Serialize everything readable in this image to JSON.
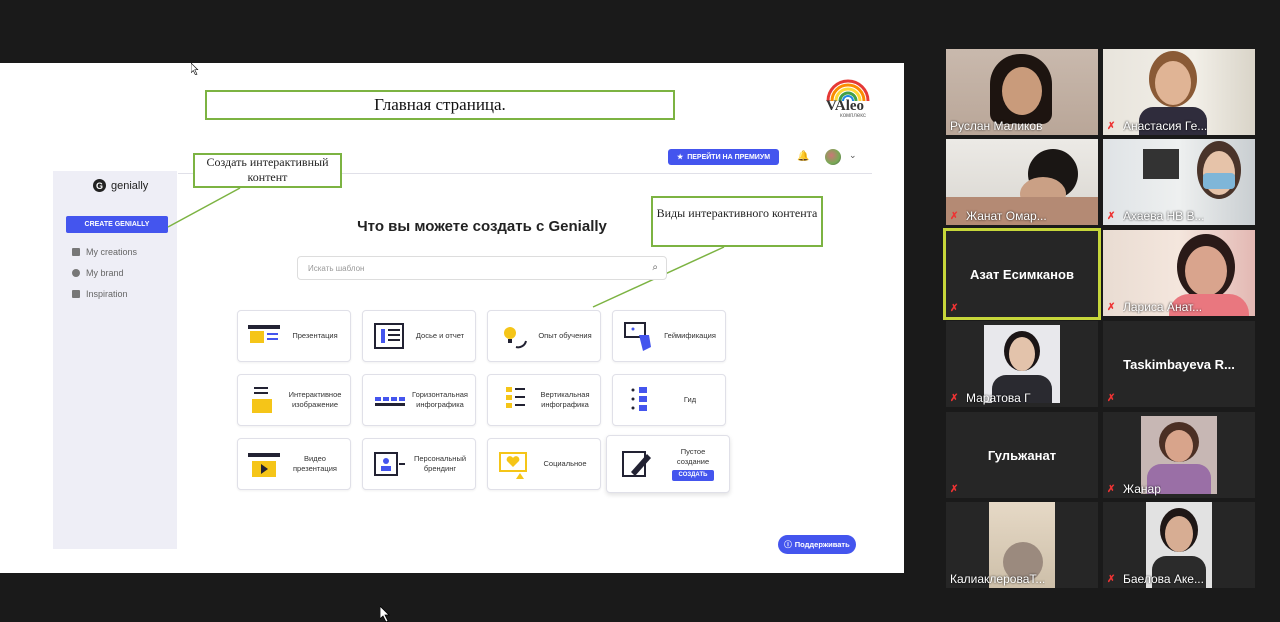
{
  "slide": {
    "title": "Главная страница.",
    "logo_text": "VAleo",
    "logo_sub": "комплекс"
  },
  "callouts": {
    "create": "Создать интерактивный контент",
    "types": "Виды интерактивного контента"
  },
  "genially": {
    "brand": "genially",
    "create_button": "CREATE GENIALLY",
    "nav": [
      "My creations",
      "My brand",
      "Inspiration"
    ],
    "premium_button": "ПЕРЕЙТИ НА ПРЕМИУМ",
    "heading": "Что вы можете создать с Genially",
    "search_placeholder": "Искать шаблон",
    "cards": [
      "Презентация",
      "Досье и отчет",
      "Опыт обучения",
      "Геймификация",
      "Интерактивное изображение",
      "Горизонтальная инфографика",
      "Вертикальная инфографика",
      "Гид",
      "Видео презентация",
      "Персональный брендинг",
      "Социальное",
      "Пустое создание"
    ],
    "empty_create_button": "СОЗДАТЬ",
    "support_button": "Поддерживать",
    "accent_color": "#4455ee",
    "icon_yellow": "#f5c518"
  },
  "participants": [
    {
      "name": "Руслан Маликов",
      "muted": false
    },
    {
      "name": "Анастасия Ге...",
      "muted": true
    },
    {
      "name": "Жанат Омар...",
      "muted": true
    },
    {
      "name": "Ахаева НВ В...",
      "muted": true
    },
    {
      "name": "Азат Есимканов",
      "muted": true
    },
    {
      "name": "Лариса Анат...",
      "muted": true
    },
    {
      "name": "Маратова Г",
      "muted": true
    },
    {
      "name": "Taskimbayeva R...",
      "muted": true
    },
    {
      "name": "Гульжанат",
      "muted": true
    },
    {
      "name": "Жанар",
      "muted": true
    },
    {
      "name": "КалиаклероваТ...",
      "muted": false
    },
    {
      "name": "Баелова Аке...",
      "muted": true
    }
  ]
}
